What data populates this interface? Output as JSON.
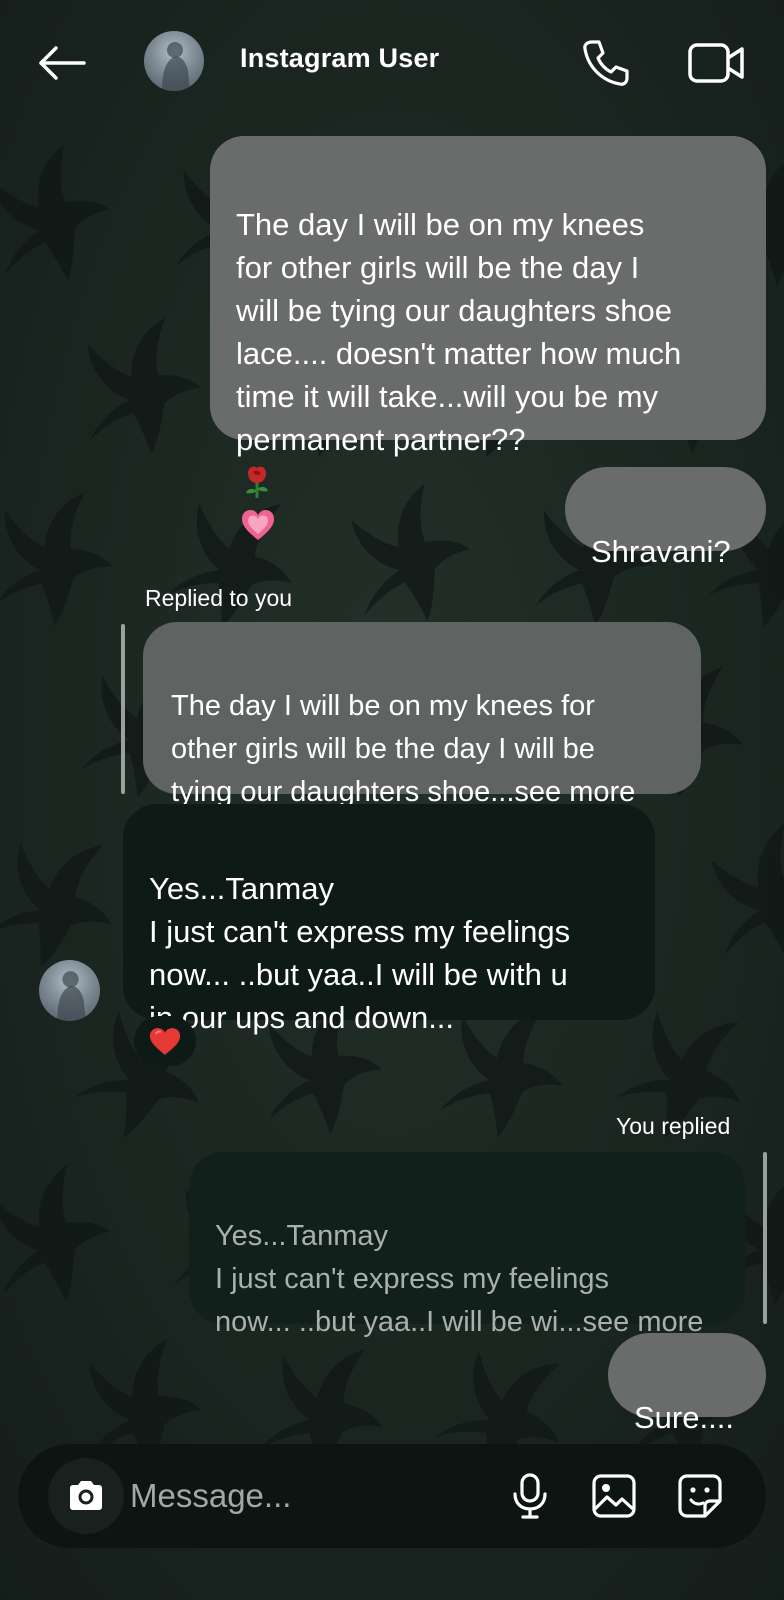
{
  "header": {
    "title": "Instagram User",
    "back_icon": "arrow-left-icon",
    "call_icon": "phone-icon",
    "video_icon": "video-camera-icon"
  },
  "messages": {
    "sent_1": {
      "text": "The day I will be on my knees\nfor other girls will be the day I\nwill be tying our daughters shoe\nlace.... doesn't matter how much\ntime it will take...will you be my\npermanent partner??",
      "emojis": [
        "rose-emoji",
        "growing-heart-emoji"
      ]
    },
    "sent_2": {
      "text": "Shravani?"
    },
    "reply_1": {
      "label": "Replied to you",
      "quote": "The day I will be on my knees for\nother girls will be the day I will be\ntying our daughters shoe...see more"
    },
    "received_1": {
      "text": "Yes...Tanmay\nI just can't express my feelings\nnow... ..but yaa..I will be with u\nin our ups and down...",
      "reaction": "red-heart-emoji"
    },
    "reply_2": {
      "label": "You replied",
      "quote": "Yes...Tanmay\nI just can't express my feelings\nnow... ..but yaa..I will be wi...see more"
    },
    "sent_3": {
      "text": "Sure...."
    }
  },
  "composer": {
    "placeholder": "Message...",
    "camera_icon": "camera-icon",
    "mic_icon": "microphone-icon",
    "gallery_icon": "image-icon",
    "sticker_icon": "sticker-icon"
  },
  "colors": {
    "background": "#1a2622",
    "sent_bubble": "#6a6c6b",
    "received_bubble": "#0e1a16",
    "quote_bubble_received": "#5f6463",
    "quote_bubble_sent": "#12201b"
  }
}
